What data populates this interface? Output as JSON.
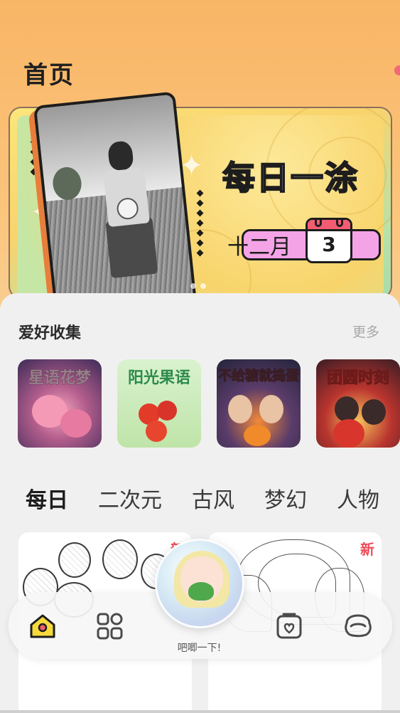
{
  "header": {
    "title": "首页"
  },
  "banner": {
    "title": "每日一涂",
    "month": "十二月",
    "day": "3"
  },
  "hobby_section": {
    "title": "爱好收集",
    "more_label": "更多",
    "collections": [
      {
        "label": "星语花梦"
      },
      {
        "label": "阳光果语"
      },
      {
        "label": "不给糖就捣蛋"
      },
      {
        "label": "团圆时刻"
      }
    ]
  },
  "category_tabs": [
    {
      "label": "每日",
      "active": true
    },
    {
      "label": "二次元",
      "active": false
    },
    {
      "label": "古风",
      "active": false
    },
    {
      "label": "梦幻",
      "active": false
    },
    {
      "label": "人物",
      "active": false
    }
  ],
  "cards": [
    {
      "badge": "新"
    },
    {
      "badge": "新"
    }
  ],
  "bottom_nav": {
    "center_caption": "吧唧一下!",
    "items": [
      {
        "icon": "home-icon",
        "active": true
      },
      {
        "icon": "grid-icon",
        "active": false
      },
      {
        "icon": "album-icon",
        "active": false
      },
      {
        "icon": "profile-icon",
        "active": false
      }
    ]
  },
  "colors": {
    "accent_yellow": "#f7e13b",
    "badge_red": "#f04b5a",
    "banner_pink": "#f4a3e6",
    "calendar_red": "#f25c73"
  }
}
